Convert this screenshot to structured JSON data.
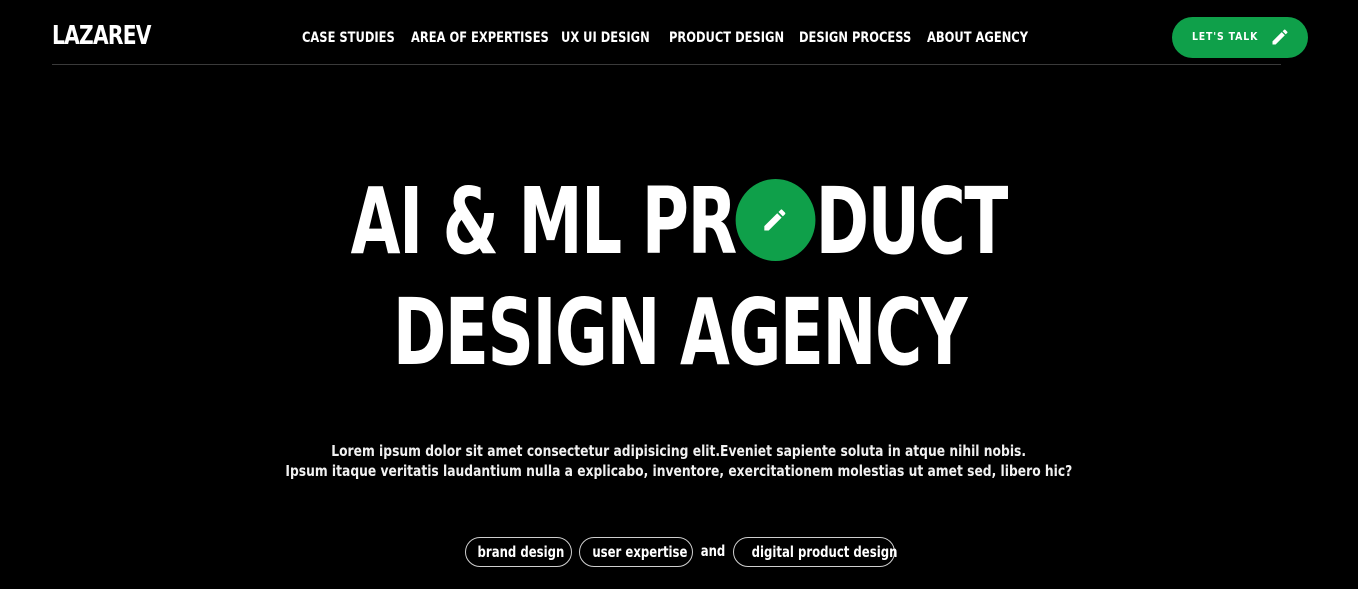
{
  "header": {
    "logo": "LAZAREV",
    "nav": [
      "CASE STUDIES",
      "AREA OF EXPERTISES",
      "UX UI DESIGN",
      "PRODUCT DESIGN",
      "DESIGN PROCESS",
      "ABOUT AGENCY"
    ],
    "cta_label": "LET'S TALK",
    "cta_icon": "pencil-icon"
  },
  "hero": {
    "line1_before": "AI & ML PR",
    "line1_after": "DUCT",
    "line2": "DESIGN AGENCY",
    "badge_icon": "pencil-icon",
    "subtitle_line1": "Lorem ipsum dolor sit amet consectetur adipisicing elit.Eveniet sapiente soluta in atque nihil nobis.",
    "subtitle_line2": "Ipsum itaque veritatis laudantium nulla a explicabo, inventore, exercitationem molestias ut amet sed, libero hic?",
    "tags": [
      "brand design",
      "user expertise",
      "digital product design"
    ],
    "connector": "and"
  },
  "colors": {
    "background": "#000000",
    "accent": "#0fa04a",
    "text": "#ffffff"
  }
}
